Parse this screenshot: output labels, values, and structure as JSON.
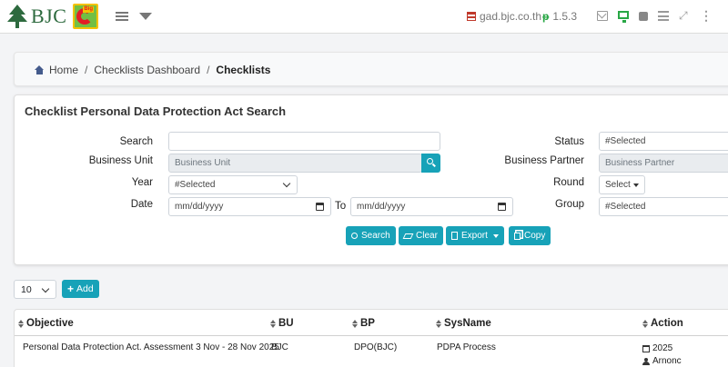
{
  "header": {
    "logo_text": "BJC",
    "domain": "gad.bjc.co.th",
    "version": "1.5.3"
  },
  "breadcrumb": {
    "home": "Home",
    "dashboard": "Checklists Dashboard",
    "current": "Checklists",
    "separator": "/"
  },
  "search": {
    "title": "Checklist Personal Data Protection Act Search",
    "labels": {
      "search": "Search",
      "business_unit": "Business Unit",
      "year": "Year",
      "date": "Date",
      "to": "To",
      "status": "Status",
      "business_partner": "Business Partner",
      "round": "Round",
      "group": "Group"
    },
    "values": {
      "search": "",
      "business_unit_placeholder": "Business Unit",
      "year": "#Selected",
      "date_from": "mm/dd/yyyy",
      "date_to": "mm/dd/yyyy",
      "status": "#Selected",
      "business_partner_placeholder": "Business Partner",
      "round": "Select",
      "group": "#Selected"
    },
    "buttons": {
      "search": "Search",
      "clear": "Clear",
      "export": "Export",
      "copy": "Copy"
    }
  },
  "list": {
    "page_length": "10",
    "add_label": "Add"
  },
  "table": {
    "columns": [
      "Objective",
      "BU",
      "BP",
      "SysName",
      "Action"
    ],
    "rows": [
      {
        "objective": "Personal Data Protection Act. Assessment 3 Nov - 28 Nov 2025",
        "bu": "BJC",
        "bp": "DPO(BJC)",
        "sysname": "PDPA Process",
        "action_year": "2025",
        "action_user": "Arnonc"
      }
    ]
  },
  "colors": {
    "accent": "#17a2b8",
    "brand_green": "#2d6a3e",
    "version_green": "#28a745"
  },
  "icons": [
    "tree-logo-icon",
    "bigc-logo-icon",
    "hamburger-icon",
    "caret-down-icon",
    "flag-icon",
    "git-branch-icon",
    "envelope-icon",
    "desktop-icon",
    "square-icon",
    "list-icon",
    "expand-icon",
    "ellipsis-icon",
    "home-icon",
    "search-icon",
    "eraser-icon",
    "file-export-icon",
    "copy-icon",
    "plus-icon",
    "sort-icon",
    "calendar-icon",
    "user-icon"
  ]
}
